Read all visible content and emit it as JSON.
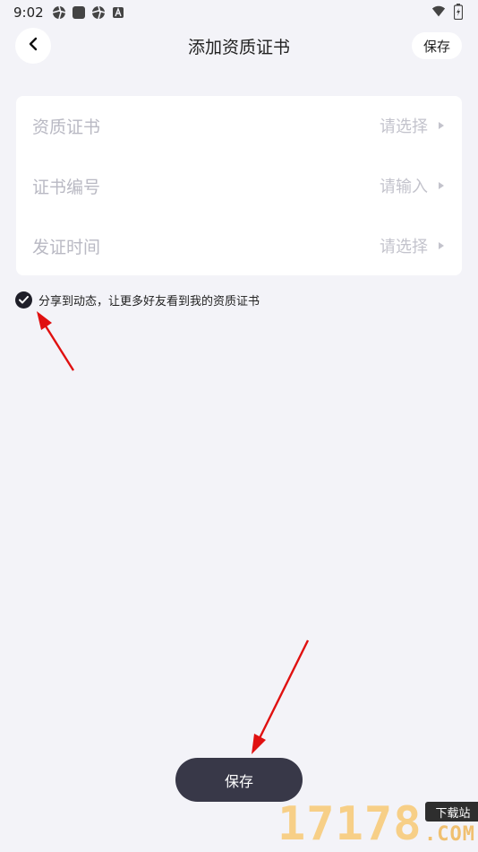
{
  "status_bar": {
    "time": "9:02"
  },
  "header": {
    "title": "添加资质证书",
    "save_label": "保存"
  },
  "form": {
    "rows": [
      {
        "label": "资质证书",
        "value": "请选择"
      },
      {
        "label": "证书编号",
        "value": "请输入"
      },
      {
        "label": "发证时间",
        "value": "请选择"
      }
    ]
  },
  "share": {
    "checked": true,
    "text": "分享到动态，让更多好友看到我的资质证书"
  },
  "bottom": {
    "save_label": "保存"
  },
  "watermark": {
    "number": "17178",
    "badge": "下载站",
    "domain": ".COM"
  },
  "colors": {
    "background": "#f3f3f8",
    "primary_button": "#383848",
    "annotation_arrow": "#e01010"
  }
}
